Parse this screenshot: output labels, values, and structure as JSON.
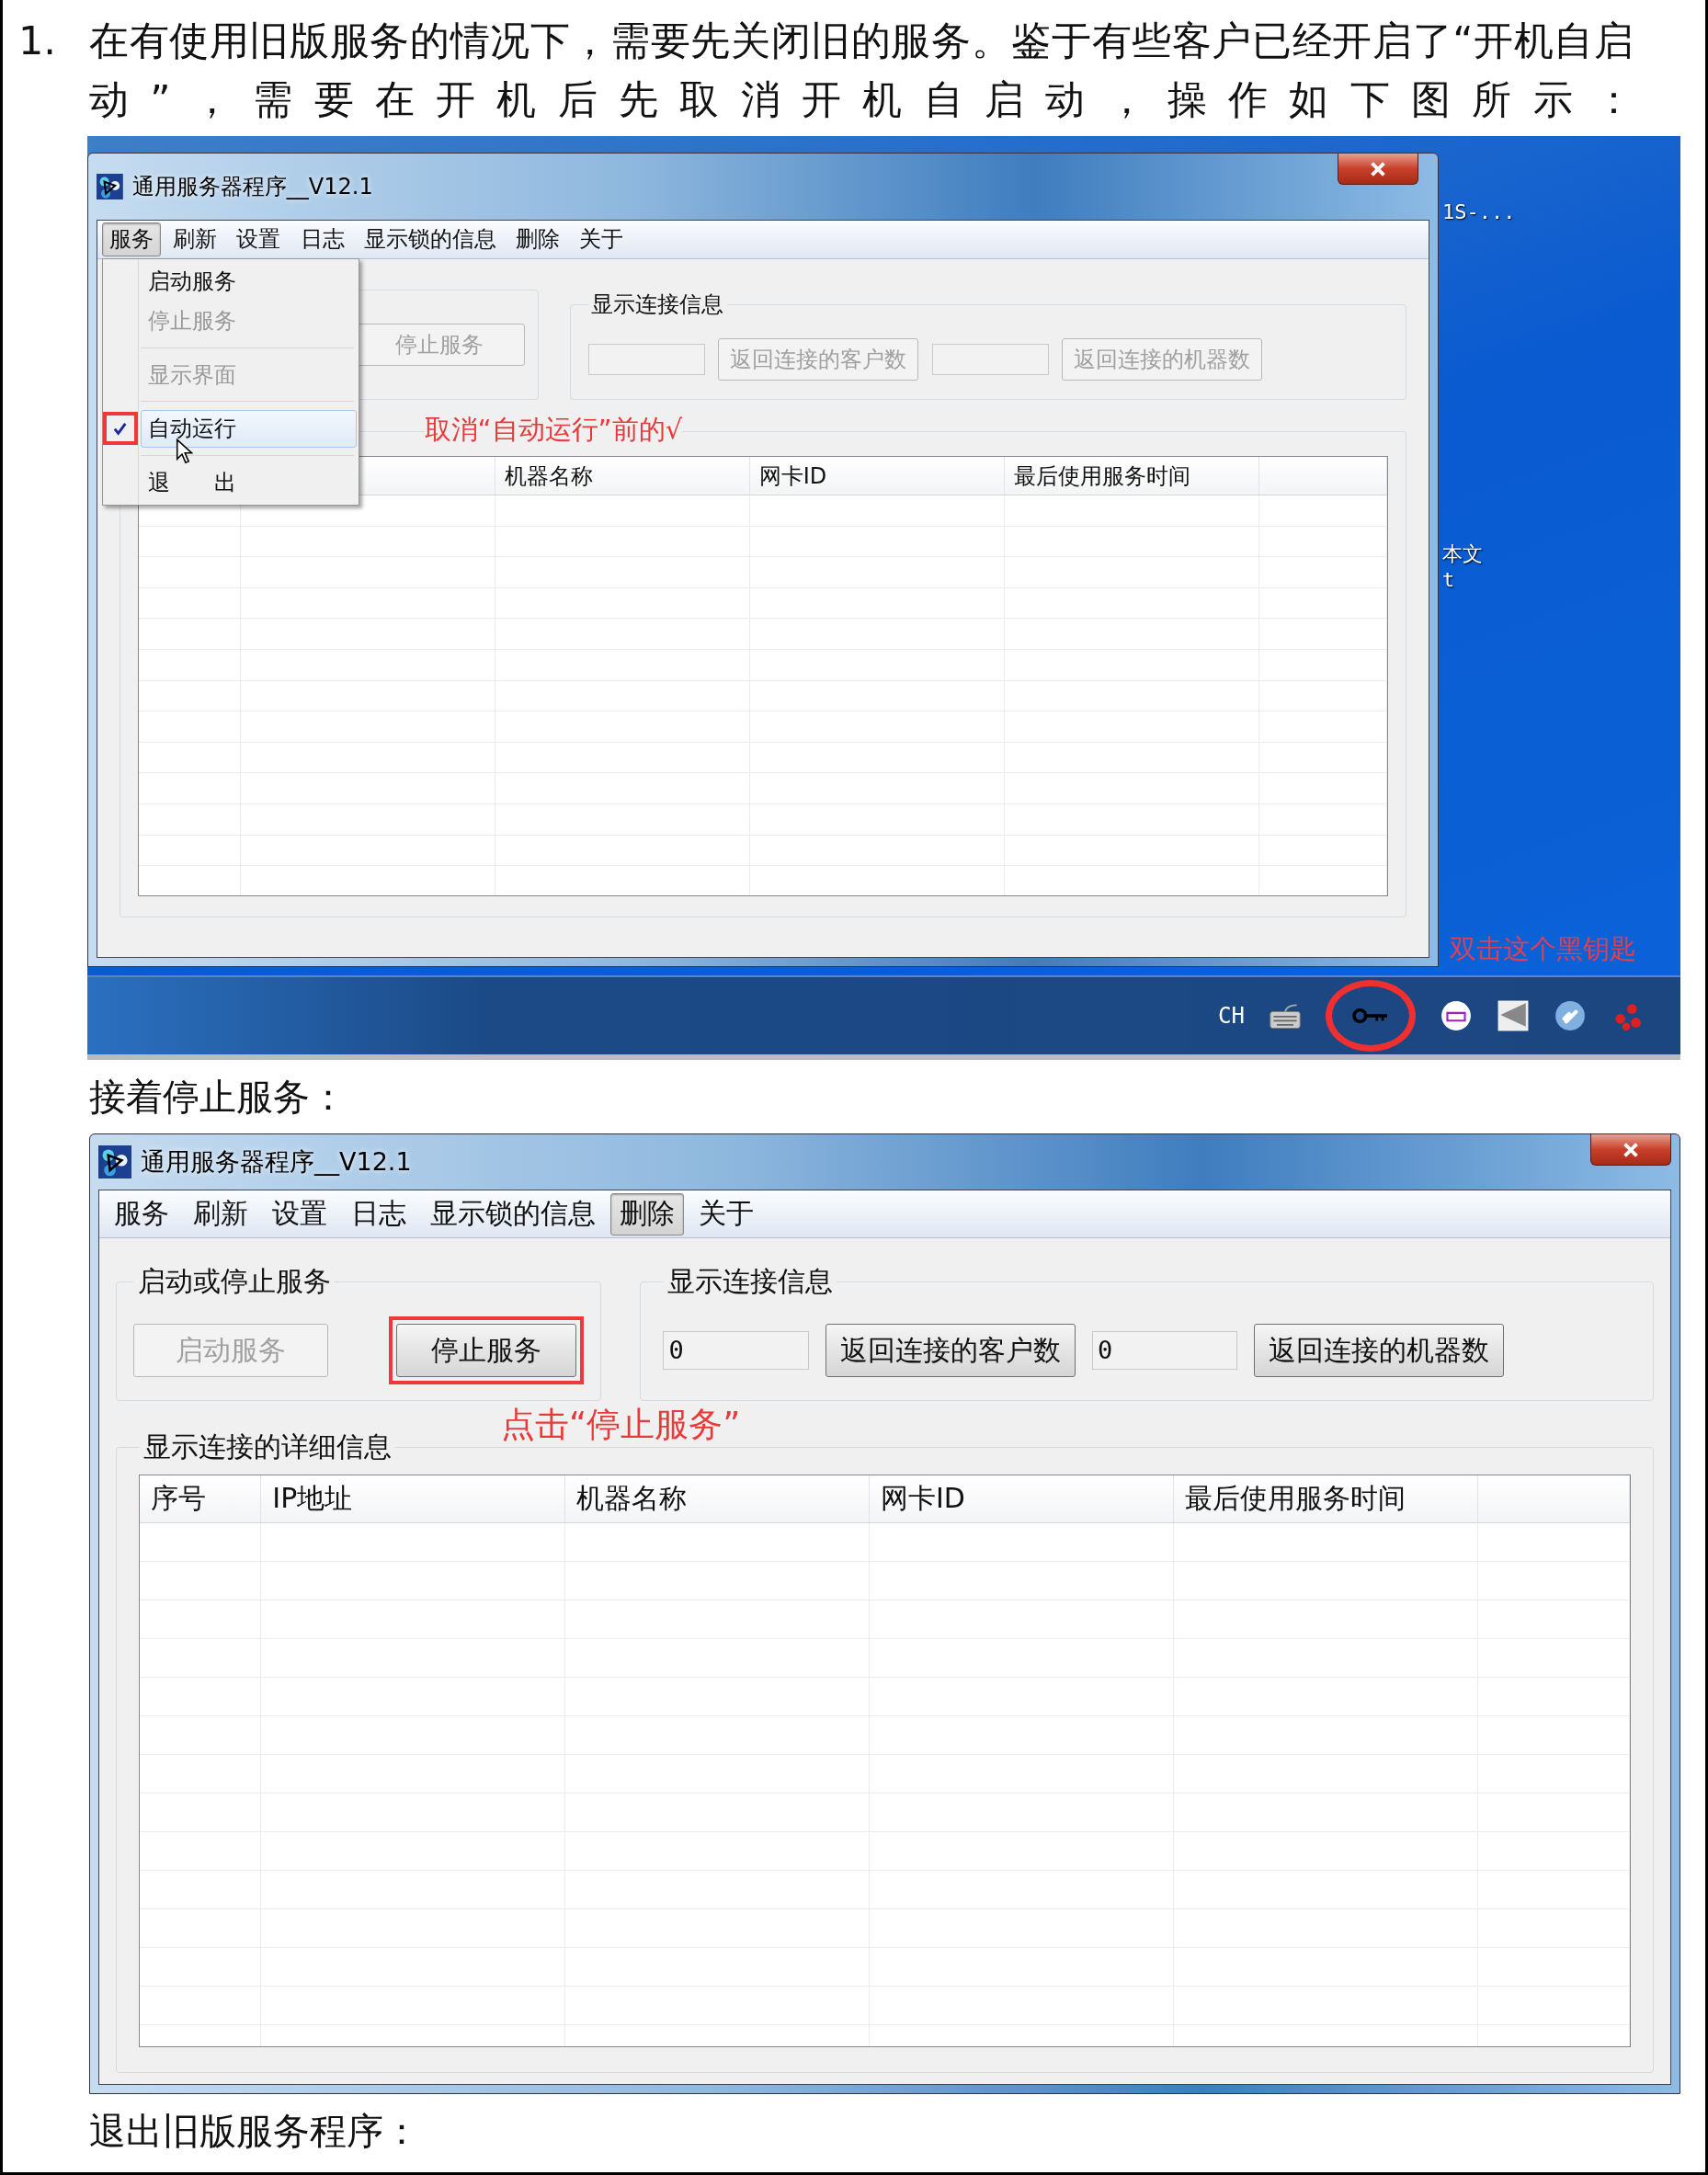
{
  "instruction": {
    "number": "1.",
    "text": "在有使用旧版服务的情况下，需要先关闭旧的服务。鉴于有些客户已经开启了“开机自启动”，需要在开机后先取消开机自启动，操作如下图所示："
  },
  "screenshot_1": {
    "window": {
      "title": "通用服务器程序__V12.1",
      "menu": [
        {
          "label": "服务",
          "selected": true
        },
        {
          "label": "刷新",
          "selected": false
        },
        {
          "label": "设置",
          "selected": false
        },
        {
          "label": "日志",
          "selected": false
        },
        {
          "label": "显示锁的信息",
          "selected": false
        },
        {
          "label": "删除",
          "selected": false
        },
        {
          "label": "关于",
          "selected": false
        }
      ],
      "service_group": {
        "buttons": [
          {
            "label": "停止服务",
            "disabled": true,
            "highlighted": false
          }
        ]
      },
      "connection_group": {
        "title": "显示连接信息",
        "items": [
          {
            "kind": "field"
          },
          {
            "kind": "button",
            "label": "返回连接的客户数",
            "disabled": true
          },
          {
            "kind": "field"
          },
          {
            "kind": "button",
            "label": "返回连接的机器数",
            "disabled": true
          }
        ]
      },
      "detail_group": {
        "columns": [
          "机器名称",
          "网卡ID",
          "最后使用服务时间"
        ]
      },
      "dropdown": [
        {
          "kind": "item",
          "label": "启动服务",
          "disabled": false,
          "checked": false,
          "selected": false
        },
        {
          "kind": "item",
          "label": "停止服务",
          "disabled": true,
          "checked": false,
          "selected": false
        },
        {
          "kind": "separator"
        },
        {
          "kind": "item",
          "label": "显示界面",
          "disabled": true,
          "checked": false,
          "selected": false
        },
        {
          "kind": "separator"
        },
        {
          "kind": "item",
          "label": "自动运行",
          "disabled": false,
          "checked": true,
          "selected": true,
          "highlighted": true,
          "cursor": true
        },
        {
          "kind": "separator"
        },
        {
          "kind": "item",
          "label": "退　　出",
          "disabled": false,
          "checked": false,
          "selected": false
        }
      ],
      "annotation": "取消“自动运行”前的√"
    },
    "desktop_icons": [
      {
        "lines": [
          "1S-..."
        ]
      },
      {
        "lines": [
          "本文",
          "t"
        ]
      }
    ],
    "desktop_note": "双击这个黑钥匙",
    "taskbar": {
      "language": "CH"
    }
  },
  "caption_1": "接着停止服务：",
  "screenshot_2": {
    "window": {
      "title": "通用服务器程序__V12.1",
      "menu": [
        {
          "label": "服务",
          "selected": false
        },
        {
          "label": "刷新",
          "selected": false
        },
        {
          "label": "设置",
          "selected": false
        },
        {
          "label": "日志",
          "selected": false
        },
        {
          "label": "显示锁的信息",
          "selected": false
        },
        {
          "label": "删除",
          "selected": true
        },
        {
          "label": "关于",
          "selected": false
        }
      ],
      "service_group": {
        "title": "启动或停止服务",
        "buttons": [
          {
            "label": "启动服务",
            "disabled": true,
            "highlighted": false
          },
          {
            "label": "停止服务",
            "disabled": false,
            "highlighted": true
          }
        ]
      },
      "connection_group": {
        "title": "显示连接信息",
        "items": [
          {
            "kind": "field",
            "value": "0"
          },
          {
            "kind": "button",
            "label": "返回连接的客户数",
            "disabled": false
          },
          {
            "kind": "field",
            "value": "0"
          },
          {
            "kind": "button",
            "label": "返回连接的机器数",
            "disabled": false
          }
        ]
      },
      "detail_group": {
        "title": "显示连接的详细信息",
        "columns": [
          "序号",
          "IP地址",
          "机器名称",
          "网卡ID",
          "最后使用服务时间"
        ]
      },
      "annotation": "点击“停止服务”"
    }
  },
  "caption_2": "退出旧版服务程序："
}
